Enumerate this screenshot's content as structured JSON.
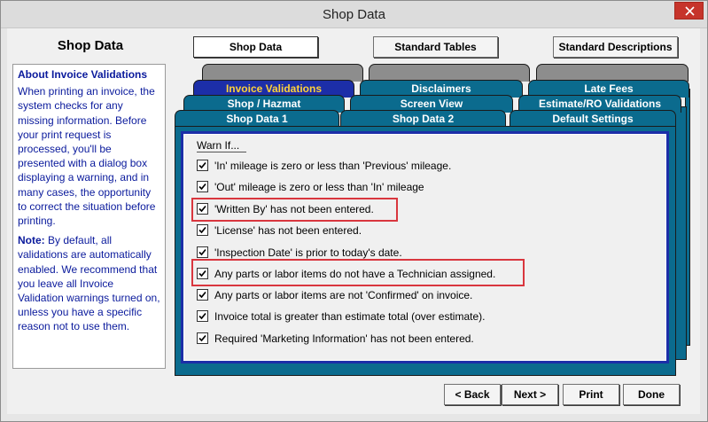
{
  "window": {
    "title": "Shop Data",
    "close_icon": "close-icon"
  },
  "left": {
    "title": "Shop Data",
    "help": {
      "heading": "About Invoice Validations",
      "body": "When printing an invoice, the system checks for any missing information. Before your print request is processed, you'll be presented with a dialog box displaying a warning, and in many cases, the opportunity to correct the situation before printing.",
      "note_label": "Note:",
      "note_text": " By default, all validations are automatically enabled. We recommend that you leave all Invoice Validation warnings turned on, unless you have a specific reason not to use them."
    }
  },
  "top_buttons": {
    "shop_data": "Shop Data",
    "standard_tables": "Standard Tables",
    "standard_descriptions": "Standard Descriptions"
  },
  "tabs": {
    "row1": [
      {
        "label": "Invoice Validations",
        "selected": true
      },
      {
        "label": "Disclaimers"
      },
      {
        "label": "Late Fees"
      }
    ],
    "row2": [
      {
        "label": "Shop / Hazmat"
      },
      {
        "label": "Screen View"
      },
      {
        "label": "Estimate/RO Validations"
      }
    ],
    "row3": [
      {
        "label": "Shop Data 1"
      },
      {
        "label": "Shop Data 2"
      },
      {
        "label": "Default Settings"
      }
    ]
  },
  "panel": {
    "group_label": "Warn If...",
    "checks": [
      {
        "label": "'In'  mileage is zero or less than 'Previous' mileage.",
        "checked": true
      },
      {
        "label": "'Out' mileage is zero or less than 'In' mileage",
        "checked": true
      },
      {
        "label": "'Written By' has not been entered.",
        "checked": true
      },
      {
        "label": "'License' has not been entered.",
        "checked": true
      },
      {
        "label": "'Inspection Date' is prior to today's date.",
        "checked": true
      },
      {
        "label": "Any parts or labor items do not have a Technician assigned.",
        "checked": true
      },
      {
        "label": "Any parts or labor items are not 'Confirmed' on invoice.",
        "checked": true
      },
      {
        "label": "Invoice total is greater than estimate total (over estimate).",
        "checked": true
      },
      {
        "label": "Required 'Marketing Information' has not been entered.",
        "checked": true
      }
    ]
  },
  "bottom_buttons": {
    "back": "< Back",
    "next": "Next >",
    "print": "Print",
    "done": "Done"
  },
  "colors": {
    "tab_blue": "#0b6b8e",
    "tab_selected": "#1c2ea8",
    "tab_selected_text": "#ffd23a",
    "help_text": "#0a1a9c",
    "highlight": "#d9363e",
    "close_red": "#c6342b"
  }
}
